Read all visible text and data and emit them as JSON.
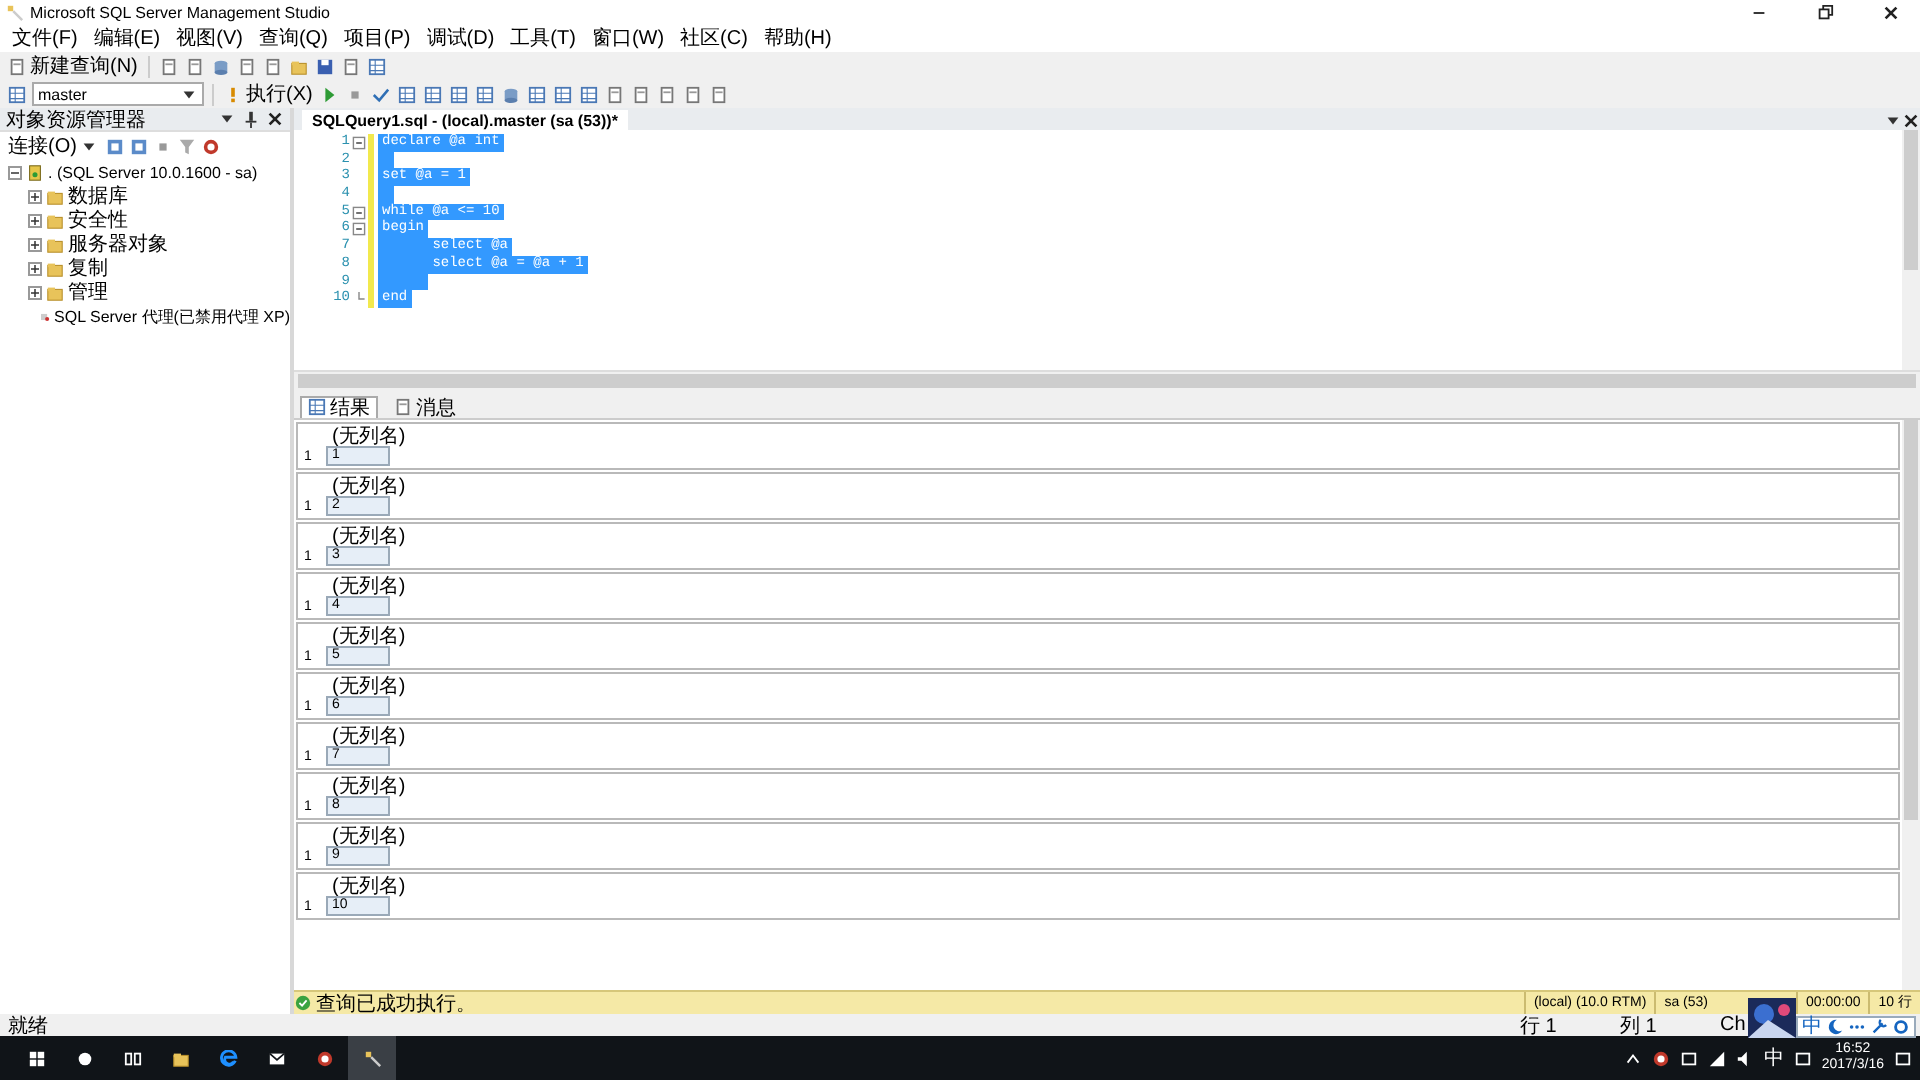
{
  "window": {
    "title": "Microsoft SQL Server Management Studio"
  },
  "menu": [
    "文件(F)",
    "编辑(E)",
    "视图(V)",
    "查询(Q)",
    "项目(P)",
    "调试(D)",
    "工具(T)",
    "窗口(W)",
    "社区(C)",
    "帮助(H)"
  ],
  "toolbar": {
    "new_query": "新建查询(N)",
    "database": "master",
    "execute": "执行(X)"
  },
  "object_explorer": {
    "title": "对象资源管理器",
    "connect": "连接(O)",
    "tree": [
      {
        "label": ". (SQL Server 10.0.1600 - sa)",
        "kind": "server",
        "expanded": true,
        "children": [
          {
            "label": "数据库",
            "kind": "folder",
            "expanded": false
          },
          {
            "label": "安全性",
            "kind": "folder",
            "expanded": false
          },
          {
            "label": "服务器对象",
            "kind": "folder",
            "expanded": false
          },
          {
            "label": "复制",
            "kind": "folder",
            "expanded": false
          },
          {
            "label": "管理",
            "kind": "folder",
            "expanded": false
          },
          {
            "label": "SQL Server 代理(已禁用代理 XP)",
            "kind": "agent"
          }
        ]
      }
    ]
  },
  "editor": {
    "tab": "SQLQuery1.sql - (local).master (sa (53))*",
    "selected": true,
    "lines": [
      {
        "number": "1",
        "text": "declare @a int",
        "fold_start": true
      },
      {
        "number": "2"
      },
      {
        "number": "3",
        "text": "set @a = 1"
      },
      {
        "number": "4"
      },
      {
        "number": "5",
        "text": "while @a <= 10",
        "fold_start": true
      },
      {
        "number": "6",
        "text": "begin",
        "fold_start": true
      },
      {
        "number": "7",
        "text": "      select @a"
      },
      {
        "number": "8",
        "text": "      select @a = @a + 1"
      },
      {
        "number": "9"
      },
      {
        "number": "10",
        "text": "end",
        "fold_end": true
      }
    ]
  },
  "results": {
    "tabs": [
      {
        "label": "结果",
        "selected": true
      },
      {
        "label": "消息",
        "selected": false
      }
    ],
    "grids": [
      {
        "column": "(无列名)",
        "row": "1",
        "value": "1"
      },
      {
        "column": "(无列名)",
        "row": "1",
        "value": "2"
      },
      {
        "column": "(无列名)",
        "row": "1",
        "value": "3"
      },
      {
        "column": "(无列名)",
        "row": "1",
        "value": "4"
      },
      {
        "column": "(无列名)",
        "row": "1",
        "value": "5"
      },
      {
        "column": "(无列名)",
        "row": "1",
        "value": "6"
      },
      {
        "column": "(无列名)",
        "row": "1",
        "value": "7"
      },
      {
        "column": "(无列名)",
        "row": "1",
        "value": "8"
      },
      {
        "column": "(无列名)",
        "row": "1",
        "value": "9"
      },
      {
        "column": "(无列名)",
        "row": "1",
        "value": "10"
      }
    ]
  },
  "query_status": {
    "message": "查询已成功执行。",
    "server": "(local) (10.0 RTM)",
    "user": "sa (53)",
    "time": "00:00:00",
    "rows": "10 行"
  },
  "status_bar": {
    "text": "就绪",
    "line": "行 1",
    "column": "列 1",
    "char": "Ch"
  },
  "ime": {
    "label": "中"
  },
  "taskbar": {
    "ime": "中",
    "time": "16:52",
    "date": "2017/3/16"
  }
}
